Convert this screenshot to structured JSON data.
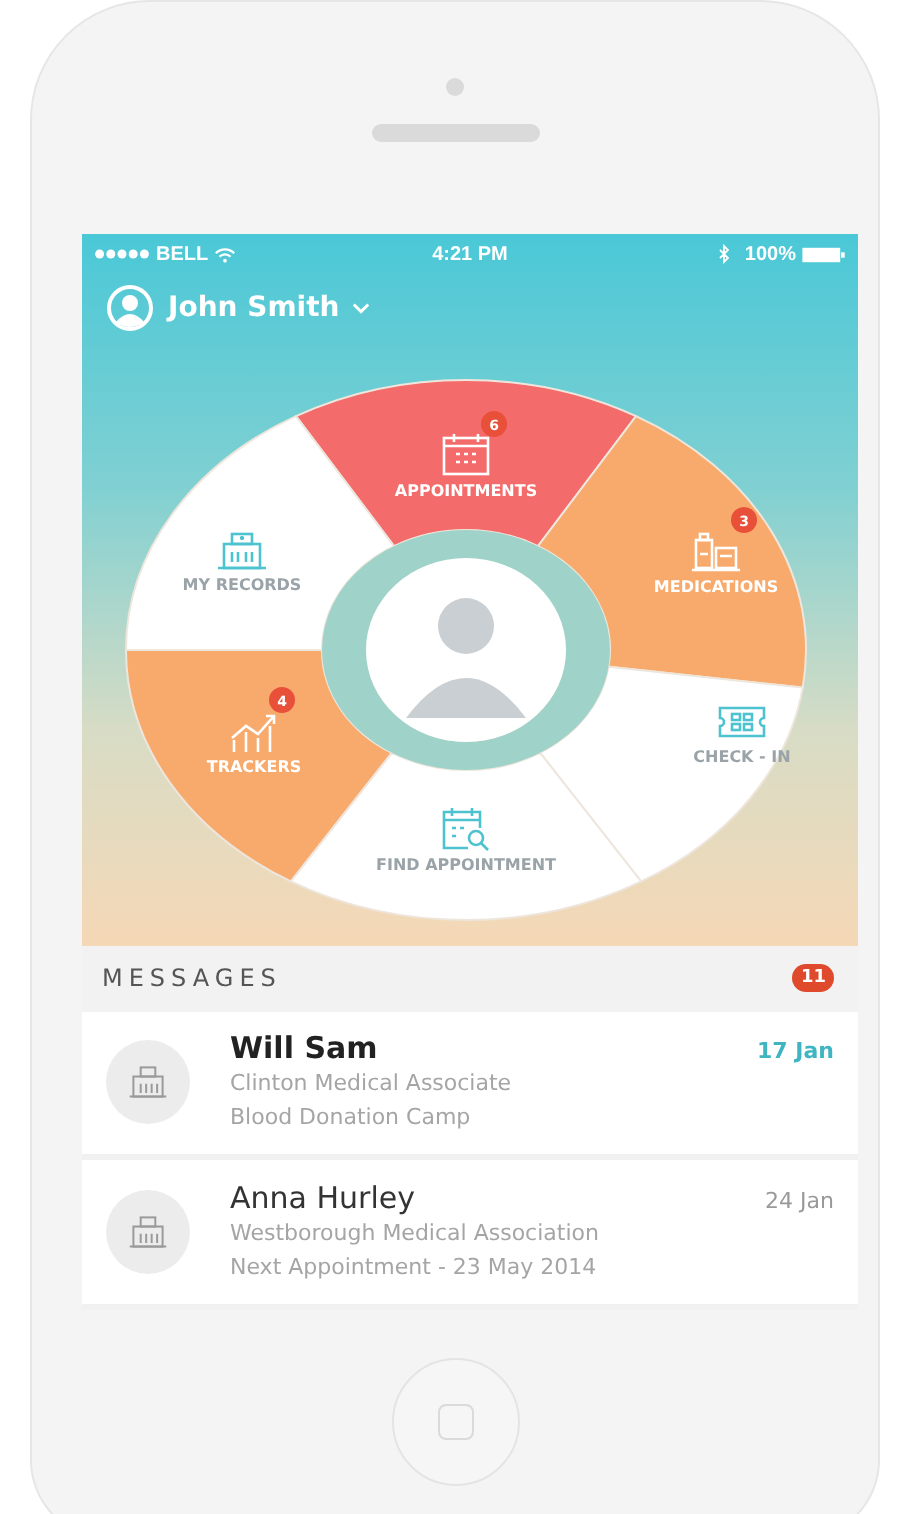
{
  "status_bar": {
    "carrier": "BELL",
    "time": "4:21 PM",
    "battery": "100%"
  },
  "user": {
    "name": "John Smith"
  },
  "wheel": {
    "segments": [
      {
        "label": "APPOINTMENTS",
        "color": "#f46b6b",
        "badge": "6"
      },
      {
        "label": "MY RECORDS",
        "color": "#ffffff"
      },
      {
        "label": "MEDICATIONS",
        "color": "#f7aa6c",
        "badge": "3"
      },
      {
        "label": "TRACKERS",
        "color": "#f7aa6c",
        "badge": "4"
      },
      {
        "label": "CHECK - IN",
        "color": "#ffffff"
      },
      {
        "label": "FIND APPOINTMENT",
        "color": "#ffffff"
      }
    ]
  },
  "messages": {
    "title": "MESSAGES",
    "count": "11",
    "items": [
      {
        "sender": "Will Sam",
        "org": "Clinton Medical Associate",
        "subject": "Blood Donation Camp",
        "date": "17 Jan",
        "unread": true
      },
      {
        "sender": "Anna Hurley",
        "org": "Westborough Medical Association",
        "subject": "Next Appointment - 23 May 2014",
        "date": "24 Jan",
        "unread": false
      }
    ]
  }
}
